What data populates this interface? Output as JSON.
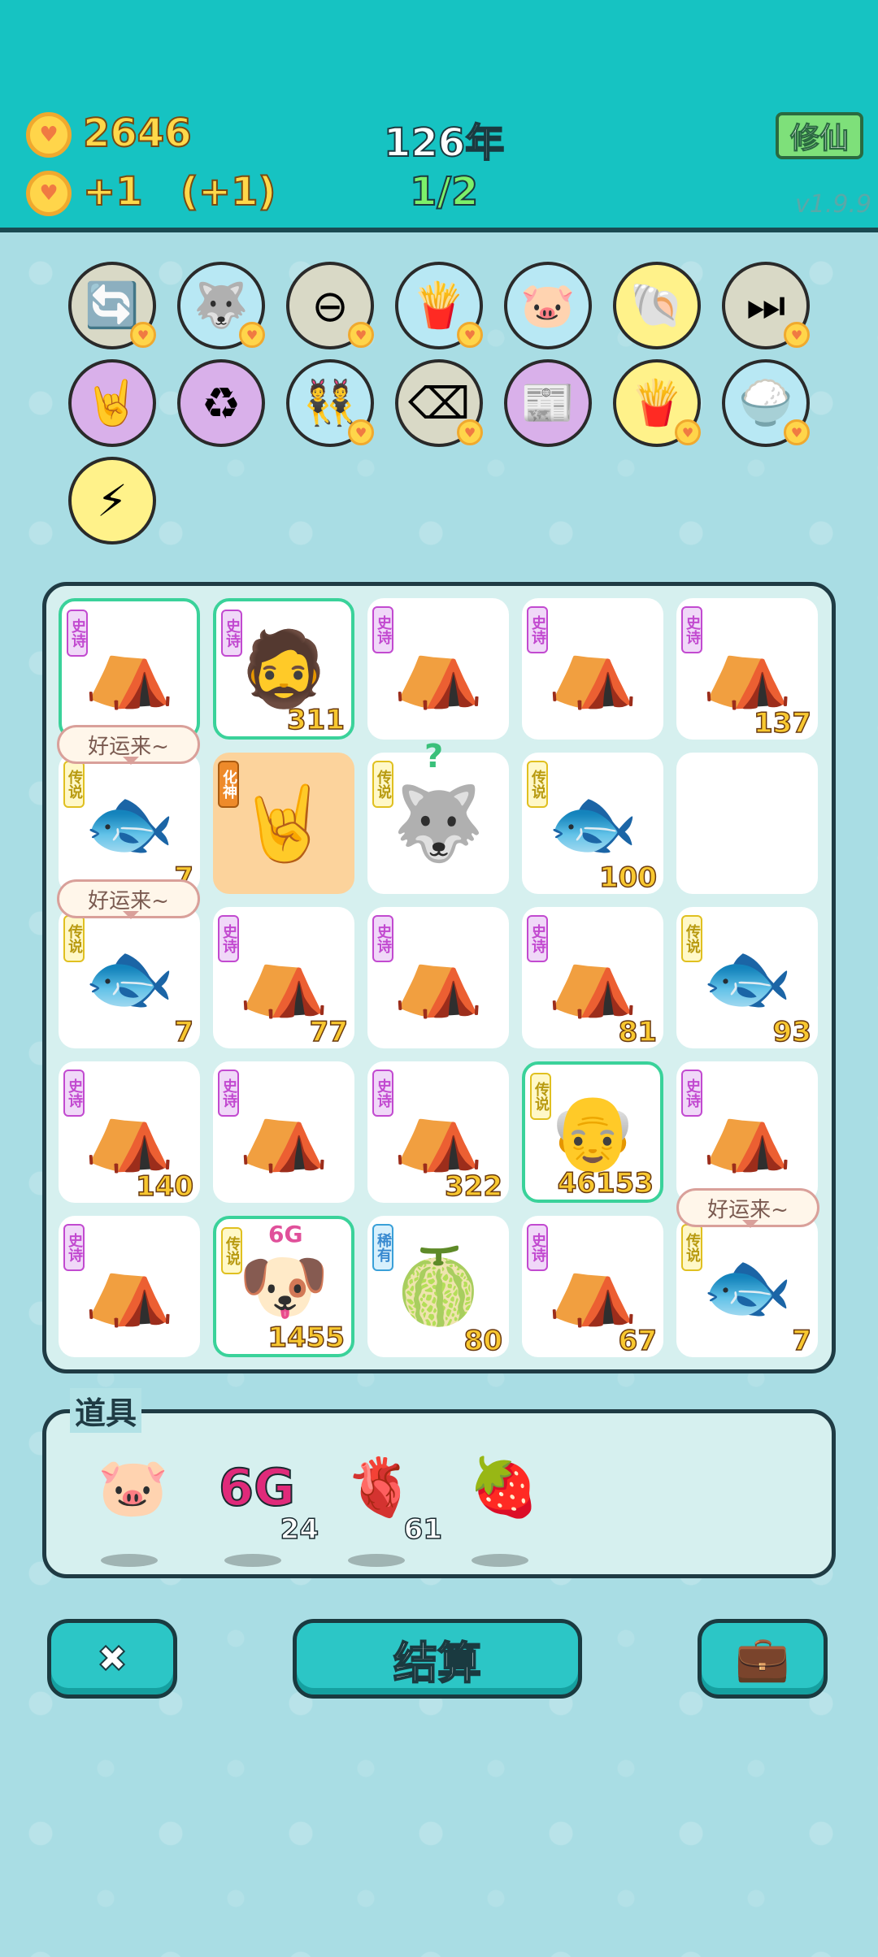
{
  "header": {
    "coins": "2646",
    "income": "+1",
    "income_bonus": "(+1)",
    "year": "126年",
    "round": "1/2",
    "mode_button": "修仙",
    "version": "v1.9.9"
  },
  "relics": [
    {
      "name": "refresh-icon",
      "glyph": "🔄",
      "bg": "#d9d9c6",
      "badge": true
    },
    {
      "name": "husky-icon",
      "glyph": "🐺",
      "bg": "#b8e8f4",
      "badge": true
    },
    {
      "name": "minus-icon",
      "glyph": "⊖",
      "bg": "#d9d9c6",
      "badge": true
    },
    {
      "name": "fries-icon",
      "glyph": "🍟",
      "bg": "#b8e8f4",
      "badge": true
    },
    {
      "name": "piggy-bank-icon",
      "glyph": "🐷",
      "bg": "#b8e8f4",
      "badge": false
    },
    {
      "name": "shell-icon",
      "glyph": "🐚",
      "bg": "#fff28a",
      "badge": false
    },
    {
      "name": "skip-icon",
      "glyph": "⏭",
      "bg": "#d9d9c6",
      "badge": true
    },
    {
      "name": "rock-hand-icon",
      "glyph": "🤘",
      "bg": "#d9b0ea",
      "badge": false
    },
    {
      "name": "recycle-icon",
      "glyph": "♻",
      "bg": "#d9b0ea",
      "badge": false
    },
    {
      "name": "twins-icon",
      "glyph": "👯",
      "bg": "#b8e8f4",
      "badge": true
    },
    {
      "name": "delete-icon",
      "glyph": "⌫",
      "bg": "#d9d9c6",
      "badge": true
    },
    {
      "name": "time-magazine-icon",
      "glyph": "📰",
      "bg": "#d9b0ea",
      "badge": false
    },
    {
      "name": "fries-icon",
      "glyph": "🍟",
      "bg": "#fff28a",
      "badge": true
    },
    {
      "name": "rice-bowl-icon",
      "glyph": "🍚",
      "bg": "#b8e8f4",
      "badge": true
    },
    {
      "name": "lightning-icon",
      "glyph": "⚡",
      "bg": "#fff28a",
      "badge": false
    }
  ],
  "grid": [
    {
      "rar": "史诗",
      "rc": "epic",
      "sym": "⛺",
      "count": "",
      "hl": true,
      "name": "tent-cell"
    },
    {
      "rar": "史诗",
      "rc": "epic",
      "sym": "🧔",
      "count": "311",
      "hl": true,
      "name": "face-cell"
    },
    {
      "rar": "史诗",
      "rc": "epic",
      "sym": "⛺",
      "count": "",
      "hl": false,
      "name": "tent-cell"
    },
    {
      "rar": "史诗",
      "rc": "epic",
      "sym": "⛺",
      "count": "",
      "hl": false,
      "name": "tent-cell"
    },
    {
      "rar": "史诗",
      "rc": "epic",
      "sym": "⛺",
      "count": "137",
      "hl": false,
      "name": "tent-cell"
    },
    {
      "rar": "传说",
      "rc": "leg",
      "sym": "🐟",
      "count": "7",
      "hl": false,
      "name": "koi-cell"
    },
    {
      "rar": "化神",
      "rc": "hs",
      "sym": "🤘",
      "count": "",
      "hl": false,
      "orange": true,
      "name": "rock-hand-cell"
    },
    {
      "rar": "传说",
      "rc": "leg",
      "sym": "🐺",
      "count": "",
      "hl": false,
      "name": "husky-king-cell"
    },
    {
      "rar": "传说",
      "rc": "leg",
      "sym": "🐟",
      "count": "100",
      "hl": false,
      "name": "koi-cell"
    },
    {
      "rar": "",
      "rc": "",
      "sym": "",
      "count": "",
      "hl": false,
      "name": "empty-cell"
    },
    {
      "rar": "传说",
      "rc": "leg",
      "sym": "🐟",
      "count": "7",
      "hl": false,
      "name": "koi-cell"
    },
    {
      "rar": "史诗",
      "rc": "epic",
      "sym": "⛺",
      "count": "77",
      "hl": false,
      "name": "tent-cell"
    },
    {
      "rar": "史诗",
      "rc": "epic",
      "sym": "⛺",
      "count": "",
      "hl": false,
      "name": "tent-cell"
    },
    {
      "rar": "史诗",
      "rc": "epic",
      "sym": "⛺",
      "count": "81",
      "hl": false,
      "name": "tent-cell"
    },
    {
      "rar": "传说",
      "rc": "leg",
      "sym": "🐟",
      "count": "93",
      "hl": false,
      "name": "koi-cell"
    },
    {
      "rar": "史诗",
      "rc": "epic",
      "sym": "⛺",
      "count": "140",
      "hl": false,
      "name": "tent-cell"
    },
    {
      "rar": "史诗",
      "rc": "epic",
      "sym": "⛺",
      "count": "",
      "hl": false,
      "name": "tent-cell"
    },
    {
      "rar": "史诗",
      "rc": "epic",
      "sym": "⛺",
      "count": "322",
      "hl": false,
      "name": "tent-cell"
    },
    {
      "rar": "传说",
      "rc": "leg",
      "sym": "👴",
      "count": "46153",
      "hl": true,
      "name": "old-man-cell"
    },
    {
      "rar": "史诗",
      "rc": "epic",
      "sym": "⛺",
      "count": "",
      "hl": false,
      "name": "tent-cell"
    },
    {
      "rar": "史诗",
      "rc": "epic",
      "sym": "⛺",
      "count": "",
      "hl": false,
      "name": "tent-cell"
    },
    {
      "rar": "传说",
      "rc": "leg",
      "sym": "🐶",
      "count": "1455",
      "hl": true,
      "name": "dog-cell",
      "extra": "6G"
    },
    {
      "rar": "稀有",
      "rc": "rare",
      "sym": "🍈",
      "count": "80",
      "hl": false,
      "name": "lychee-cell"
    },
    {
      "rar": "史诗",
      "rc": "epic",
      "sym": "⛺",
      "count": "67",
      "hl": false,
      "name": "tent-cell"
    },
    {
      "rar": "传说",
      "rc": "leg",
      "sym": "🐟",
      "count": "7",
      "hl": false,
      "name": "koi-cell"
    }
  ],
  "bubbles": [
    "好运来~",
    "好运来~",
    "好运来~"
  ],
  "question_mark": "?",
  "items_panel": {
    "title": "道具",
    "items": [
      {
        "name": "piggy-bank-item",
        "glyph": "🐷",
        "count": ""
      },
      {
        "name": "6g-item",
        "glyph": "6G",
        "count": "24"
      },
      {
        "name": "liver-item",
        "glyph": "🫀",
        "count": "61"
      },
      {
        "name": "bayberry-item",
        "glyph": "🍓",
        "count": ""
      }
    ]
  },
  "buttons": {
    "settle": "结算",
    "delete_glyph": "✖",
    "bag_glyph": "💼"
  }
}
